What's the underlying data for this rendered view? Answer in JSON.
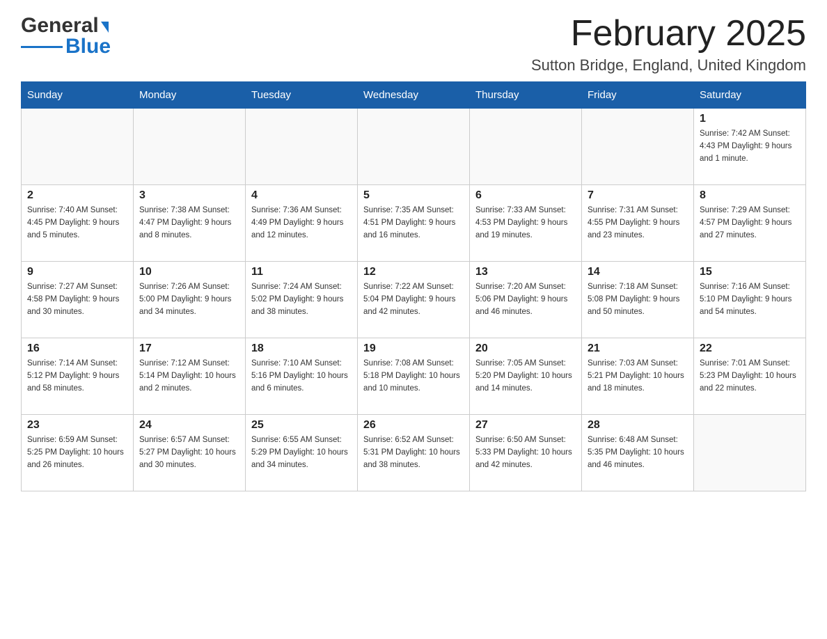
{
  "header": {
    "logo_main": "General",
    "logo_sub": "Blue",
    "month_title": "February 2025",
    "location": "Sutton Bridge, England, United Kingdom"
  },
  "weekdays": [
    "Sunday",
    "Monday",
    "Tuesday",
    "Wednesday",
    "Thursday",
    "Friday",
    "Saturday"
  ],
  "weeks": [
    [
      {
        "day": "",
        "info": ""
      },
      {
        "day": "",
        "info": ""
      },
      {
        "day": "",
        "info": ""
      },
      {
        "day": "",
        "info": ""
      },
      {
        "day": "",
        "info": ""
      },
      {
        "day": "",
        "info": ""
      },
      {
        "day": "1",
        "info": "Sunrise: 7:42 AM\nSunset: 4:43 PM\nDaylight: 9 hours and 1 minute."
      }
    ],
    [
      {
        "day": "2",
        "info": "Sunrise: 7:40 AM\nSunset: 4:45 PM\nDaylight: 9 hours and 5 minutes."
      },
      {
        "day": "3",
        "info": "Sunrise: 7:38 AM\nSunset: 4:47 PM\nDaylight: 9 hours and 8 minutes."
      },
      {
        "day": "4",
        "info": "Sunrise: 7:36 AM\nSunset: 4:49 PM\nDaylight: 9 hours and 12 minutes."
      },
      {
        "day": "5",
        "info": "Sunrise: 7:35 AM\nSunset: 4:51 PM\nDaylight: 9 hours and 16 minutes."
      },
      {
        "day": "6",
        "info": "Sunrise: 7:33 AM\nSunset: 4:53 PM\nDaylight: 9 hours and 19 minutes."
      },
      {
        "day": "7",
        "info": "Sunrise: 7:31 AM\nSunset: 4:55 PM\nDaylight: 9 hours and 23 minutes."
      },
      {
        "day": "8",
        "info": "Sunrise: 7:29 AM\nSunset: 4:57 PM\nDaylight: 9 hours and 27 minutes."
      }
    ],
    [
      {
        "day": "9",
        "info": "Sunrise: 7:27 AM\nSunset: 4:58 PM\nDaylight: 9 hours and 30 minutes."
      },
      {
        "day": "10",
        "info": "Sunrise: 7:26 AM\nSunset: 5:00 PM\nDaylight: 9 hours and 34 minutes."
      },
      {
        "day": "11",
        "info": "Sunrise: 7:24 AM\nSunset: 5:02 PM\nDaylight: 9 hours and 38 minutes."
      },
      {
        "day": "12",
        "info": "Sunrise: 7:22 AM\nSunset: 5:04 PM\nDaylight: 9 hours and 42 minutes."
      },
      {
        "day": "13",
        "info": "Sunrise: 7:20 AM\nSunset: 5:06 PM\nDaylight: 9 hours and 46 minutes."
      },
      {
        "day": "14",
        "info": "Sunrise: 7:18 AM\nSunset: 5:08 PM\nDaylight: 9 hours and 50 minutes."
      },
      {
        "day": "15",
        "info": "Sunrise: 7:16 AM\nSunset: 5:10 PM\nDaylight: 9 hours and 54 minutes."
      }
    ],
    [
      {
        "day": "16",
        "info": "Sunrise: 7:14 AM\nSunset: 5:12 PM\nDaylight: 9 hours and 58 minutes."
      },
      {
        "day": "17",
        "info": "Sunrise: 7:12 AM\nSunset: 5:14 PM\nDaylight: 10 hours and 2 minutes."
      },
      {
        "day": "18",
        "info": "Sunrise: 7:10 AM\nSunset: 5:16 PM\nDaylight: 10 hours and 6 minutes."
      },
      {
        "day": "19",
        "info": "Sunrise: 7:08 AM\nSunset: 5:18 PM\nDaylight: 10 hours and 10 minutes."
      },
      {
        "day": "20",
        "info": "Sunrise: 7:05 AM\nSunset: 5:20 PM\nDaylight: 10 hours and 14 minutes."
      },
      {
        "day": "21",
        "info": "Sunrise: 7:03 AM\nSunset: 5:21 PM\nDaylight: 10 hours and 18 minutes."
      },
      {
        "day": "22",
        "info": "Sunrise: 7:01 AM\nSunset: 5:23 PM\nDaylight: 10 hours and 22 minutes."
      }
    ],
    [
      {
        "day": "23",
        "info": "Sunrise: 6:59 AM\nSunset: 5:25 PM\nDaylight: 10 hours and 26 minutes."
      },
      {
        "day": "24",
        "info": "Sunrise: 6:57 AM\nSunset: 5:27 PM\nDaylight: 10 hours and 30 minutes."
      },
      {
        "day": "25",
        "info": "Sunrise: 6:55 AM\nSunset: 5:29 PM\nDaylight: 10 hours and 34 minutes."
      },
      {
        "day": "26",
        "info": "Sunrise: 6:52 AM\nSunset: 5:31 PM\nDaylight: 10 hours and 38 minutes."
      },
      {
        "day": "27",
        "info": "Sunrise: 6:50 AM\nSunset: 5:33 PM\nDaylight: 10 hours and 42 minutes."
      },
      {
        "day": "28",
        "info": "Sunrise: 6:48 AM\nSunset: 5:35 PM\nDaylight: 10 hours and 46 minutes."
      },
      {
        "day": "",
        "info": ""
      }
    ]
  ]
}
